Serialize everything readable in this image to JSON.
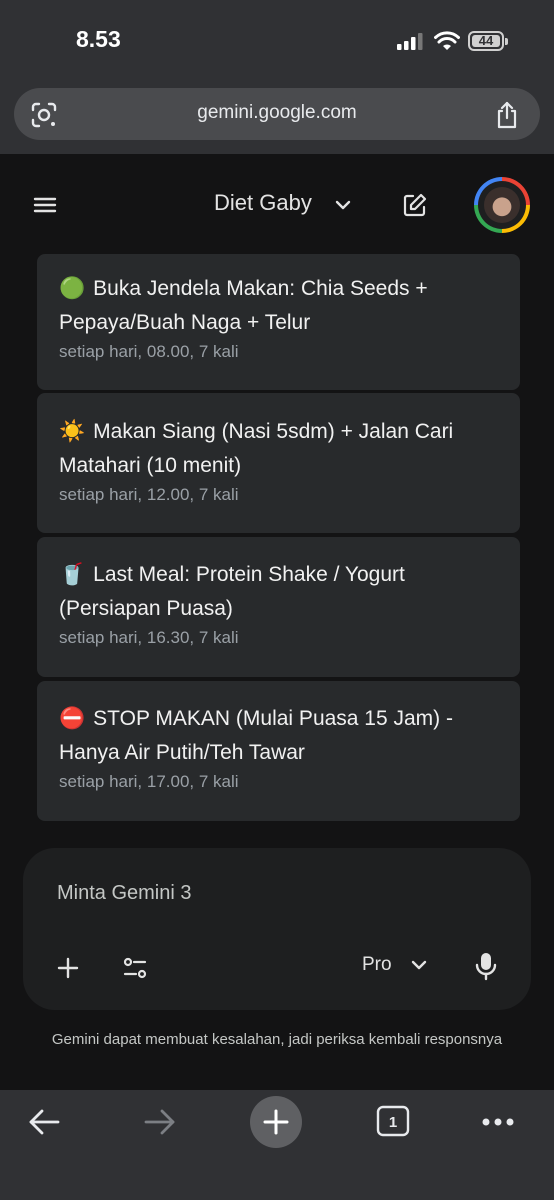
{
  "status_bar": {
    "time": "8.53",
    "battery": "44"
  },
  "browser": {
    "url": "gemini.google.com"
  },
  "header": {
    "title": "Diet Gaby"
  },
  "reminders": [
    {
      "emoji": "🟢",
      "title": "Buka Jendela Makan: Chia Seeds + Pepaya/Buah Naga + Telur",
      "schedule": "setiap hari, 08.00, 7 kali"
    },
    {
      "emoji": "☀️",
      "title": "Makan Siang (Nasi 5sdm) + Jalan Cari Matahari (10 menit)",
      "schedule": "setiap hari, 12.00, 7 kali"
    },
    {
      "emoji": "🥤",
      "title": "Last Meal: Protein Shake / Yogurt (Persiapan Puasa)",
      "schedule": "setiap hari, 16.30, 7 kali"
    },
    {
      "emoji": "⛔",
      "title": "STOP MAKAN (Mulai Puasa 15 Jam) - Hanya Air Putih/Teh Tawar",
      "schedule": "setiap hari, 17.00, 7 kali"
    }
  ],
  "composer": {
    "placeholder": "Minta Gemini 3",
    "mode": "Pro"
  },
  "disclaimer": "Gemini dapat membuat kesalahan, jadi periksa kembali responsnya",
  "bottom_nav": {
    "tab_count": "1"
  },
  "icons": {
    "lens": "google-lens-icon",
    "share": "share-icon",
    "menu": "menu-icon",
    "edit": "new-chat-icon",
    "plus": "plus-icon",
    "tools": "tools-icon",
    "mic": "microphone-icon",
    "back": "back-arrow-icon",
    "forward": "forward-arrow-icon",
    "new_tab": "new-tab-icon",
    "tabs": "tab-switcher-icon",
    "more": "more-icon"
  }
}
